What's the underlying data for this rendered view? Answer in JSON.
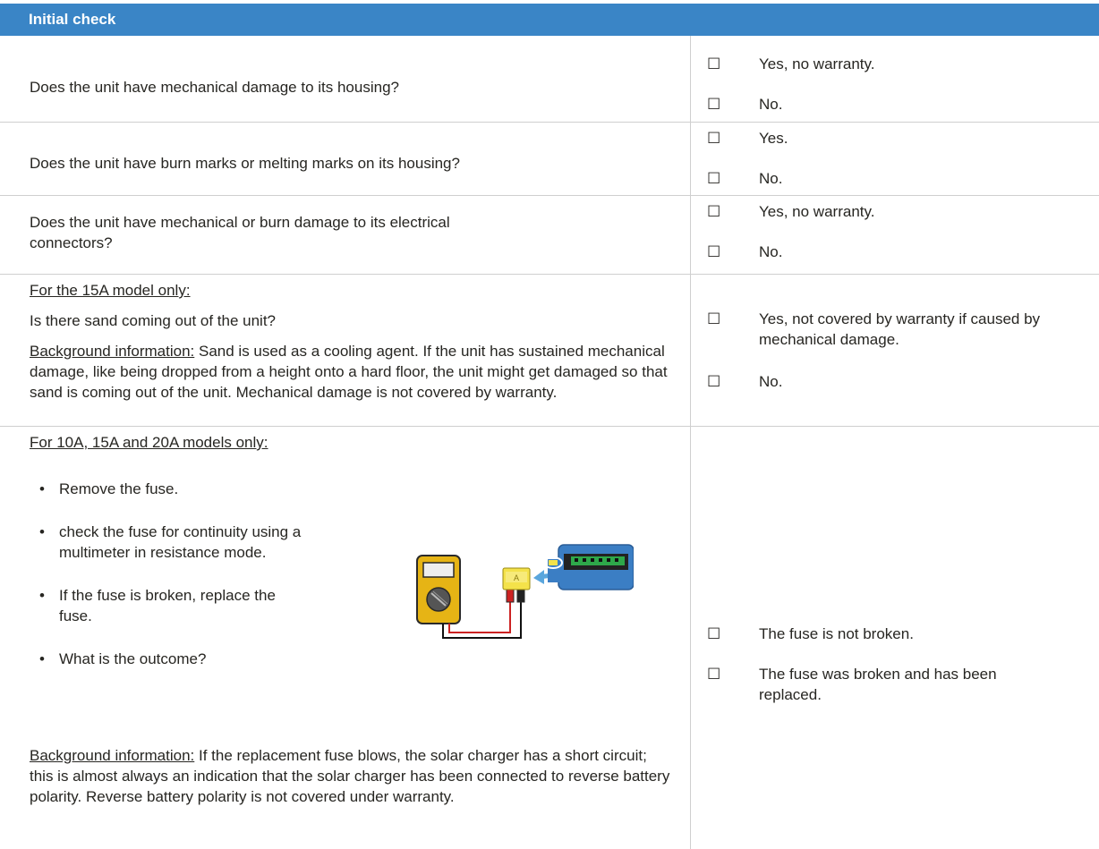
{
  "header": {
    "title": "Initial check"
  },
  "checkbox_glyph": "☐",
  "bullet_glyph": "•",
  "rows": [
    {
      "question": "Does the unit have mechanical damage to its housing?",
      "options": [
        "Yes, no warranty.",
        "No."
      ]
    },
    {
      "question": "Does the unit have burn marks or melting marks on its housing?",
      "options": [
        "Yes.",
        "No."
      ]
    },
    {
      "question_line1": "Does the unit have mechanical or burn damage to its electrical",
      "question_line2": "connectors?",
      "options": [
        "Yes, no warranty.",
        "No."
      ]
    },
    {
      "heading": "For the 15A model only:",
      "question": "Is there sand coming out of the unit?",
      "background_label": "Background information:",
      "background_text": " Sand is used as a cooling agent. If the unit has sustained mechanical damage, like being dropped from a height onto a hard floor, the unit might get damaged so that sand is coming out of the unit. Mechanical damage is not covered by warranty.",
      "options": [
        "Yes, not covered by warranty if caused by mechanical damage.",
        "No."
      ]
    },
    {
      "heading": "For 10A, 15A and 20A models only:",
      "steps": [
        "Remove the fuse.",
        "check the fuse for continuity using a multimeter in resistance mode.",
        "If the fuse is broken, replace the fuse.",
        "What is the outcome?"
      ],
      "background_label": "Background information:",
      "background_text": " If the replacement fuse blows, the solar charger has a short circuit; this is almost always an indication that the solar charger has been connected to reverse battery polarity. Reverse battery polarity is not covered under warranty.",
      "options": [
        "The fuse is not broken.",
        "The fuse was broken and has been replaced."
      ],
      "illustration": {
        "icon": "multimeter-fuse-illustration"
      }
    }
  ]
}
